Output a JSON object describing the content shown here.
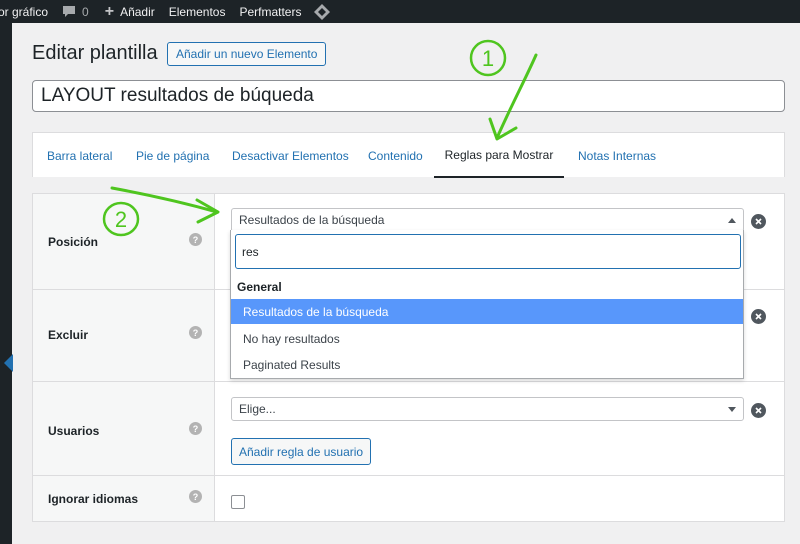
{
  "admin_bar": {
    "editor_text": "or gráfico",
    "comments_count": "0",
    "new_label": "Añadir",
    "elementos_label": "Elementos",
    "perfmatters_label": "Perfmatters"
  },
  "header": {
    "title": "Editar plantilla",
    "add_new_label": "Añadir un nuevo Elemento"
  },
  "post_title": {
    "value": "LAYOUT resultados de búqueda"
  },
  "tabs": [
    {
      "label": "Barra lateral",
      "active": false
    },
    {
      "label": "Pie de página",
      "active": false
    },
    {
      "label": "Desactivar Elementos",
      "active": false
    },
    {
      "label": "Contenido",
      "active": false
    },
    {
      "label": "Reglas para Mostrar",
      "active": true
    },
    {
      "label": "Notas Internas",
      "active": false
    }
  ],
  "rules": {
    "position": {
      "label": "Posición",
      "selected": "Resultados de la búsqueda"
    },
    "exclude": {
      "label": "Excluir"
    },
    "users": {
      "label": "Usuarios",
      "placeholder": "Elige...",
      "add_rule_label": "Añadir regla de usuario"
    },
    "ignore_languages": {
      "label": "Ignorar idiomas",
      "checked": false
    }
  },
  "dropdown": {
    "search_value": "res",
    "group_label": "General",
    "options": [
      {
        "label": "Resultados de la búsqueda",
        "highlighted": true
      },
      {
        "label": "No hay resultados",
        "highlighted": false
      },
      {
        "label": "Paginated Results",
        "highlighted": false
      }
    ]
  },
  "annotations": {
    "step1": "1",
    "step2": "2"
  },
  "colors": {
    "accent": "#2271b1",
    "highlight": "#5897fb",
    "annotation": "#4fc51f",
    "admin_bar": "#1d2327"
  }
}
